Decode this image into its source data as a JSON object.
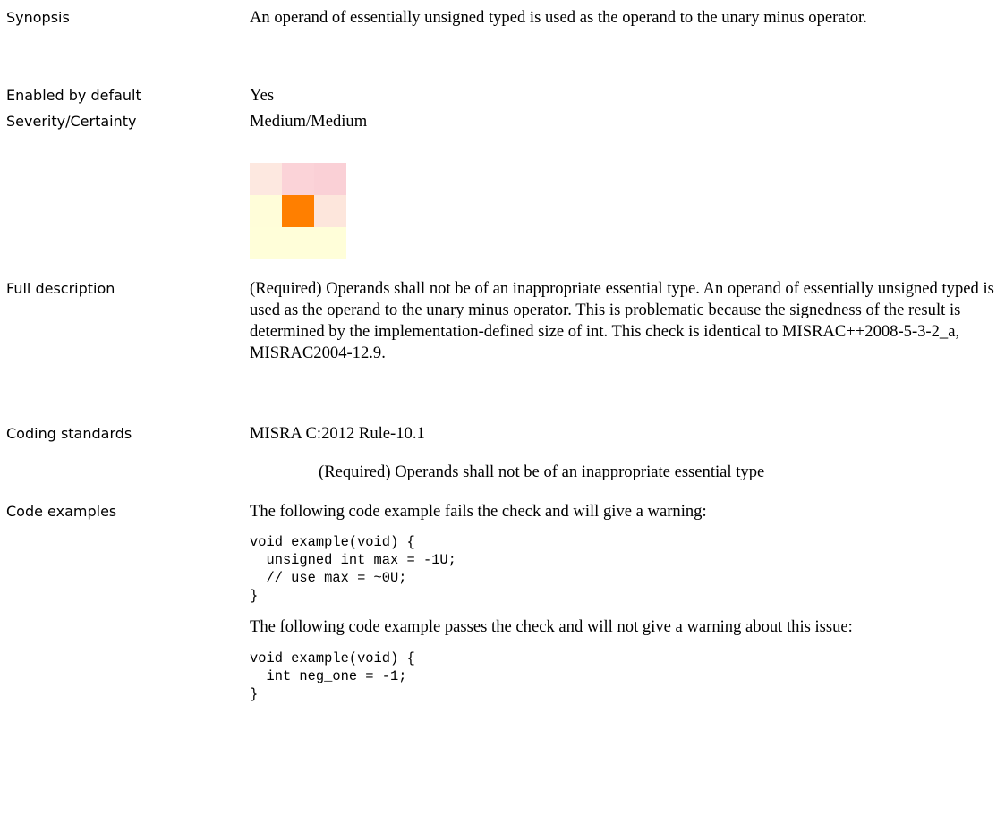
{
  "rows": {
    "synopsis": {
      "label": "Synopsis",
      "text": "An operand of essentially unsigned typed is used as the operand to the unary minus operator."
    },
    "enabled": {
      "label": "Enabled by default",
      "text": "Yes"
    },
    "severity": {
      "label": "Severity/Certainty",
      "text": "Medium/Medium",
      "matrix": {
        "rows": 3,
        "cols": 3,
        "highlighted": {
          "row": 2,
          "col": 2
        },
        "colors": {
          "r1c1": "#fde8e0",
          "r1c2": "#fbd3d8",
          "r1c3": "#fad0d6",
          "r2c1": "#fffdd9",
          "r2c2": "#ff7f00",
          "r2c3": "#fde6dc",
          "r3c1": "#fffed9",
          "r3c2": "#fffed9",
          "r3c3": "#fffed9"
        }
      }
    },
    "full_description": {
      "label": "Full description",
      "text": " (Required) Operands shall not be of an inappropriate essential type. An operand of essentially unsigned typed is used as the operand to the unary minus operator. This is problematic because the signedness of the result is determined by the implementation-defined size of int. This check is identical to MISRAC++2008-5-3-2_a, MISRAC2004-12.9."
    },
    "coding_standards": {
      "label": "Coding standards",
      "standard": "MISRA C:2012 Rule-10.1",
      "rule_text": "(Required) Operands shall not be of an inappropriate essential type"
    },
    "code_examples": {
      "label": "Code examples",
      "fail_intro": "The following code example fails the check and will give a warning:",
      "fail_code": "void example(void) {\n  unsigned int max = -1U;\n  // use max = ~0U;\n}",
      "pass_intro": "The following code example passes the check and will not give a warning about this issue:",
      "pass_code": "void example(void) {\n  int neg_one = -1;\n}"
    }
  }
}
